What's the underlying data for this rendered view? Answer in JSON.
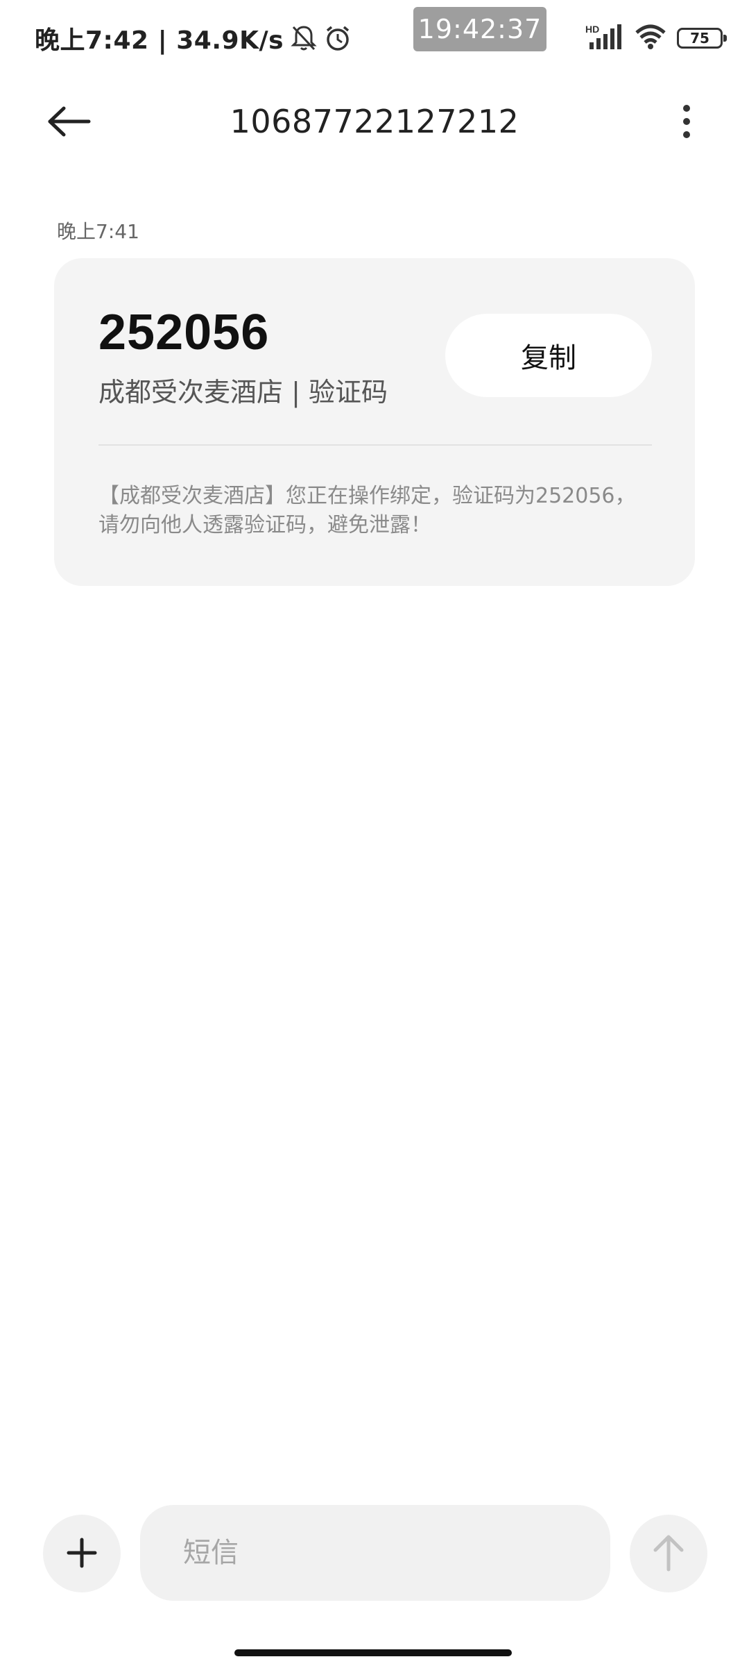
{
  "status_bar": {
    "time_text": "晚上7:42 | 34.9K/s",
    "clock_badge": "19:42:37",
    "network_label": "HD",
    "battery": "75",
    "icons": [
      "bell-off-icon",
      "alarm-icon",
      "signal-icon",
      "wifi-icon",
      "battery-icon"
    ]
  },
  "app_bar": {
    "title": "10687722127212",
    "back_icon": "arrow-left-icon",
    "more_icon": "more-vertical-icon"
  },
  "message": {
    "time": "晚上7:41",
    "code": "252056",
    "code_subtitle": "成都受次麦酒店 | 验证码",
    "copy_label": "复制",
    "body": "【成都受次麦酒店】您正在操作绑定，验证码为252056，请勿向他人透露验证码，避免泄露！"
  },
  "composer": {
    "add_icon": "plus-icon",
    "placeholder": "短信",
    "send_icon": "arrow-up-icon"
  },
  "colors": {
    "card_bg": "#f4f4f4",
    "composer_bg": "#f1f1f1",
    "clock_badge_bg": "#9e9e9e"
  }
}
